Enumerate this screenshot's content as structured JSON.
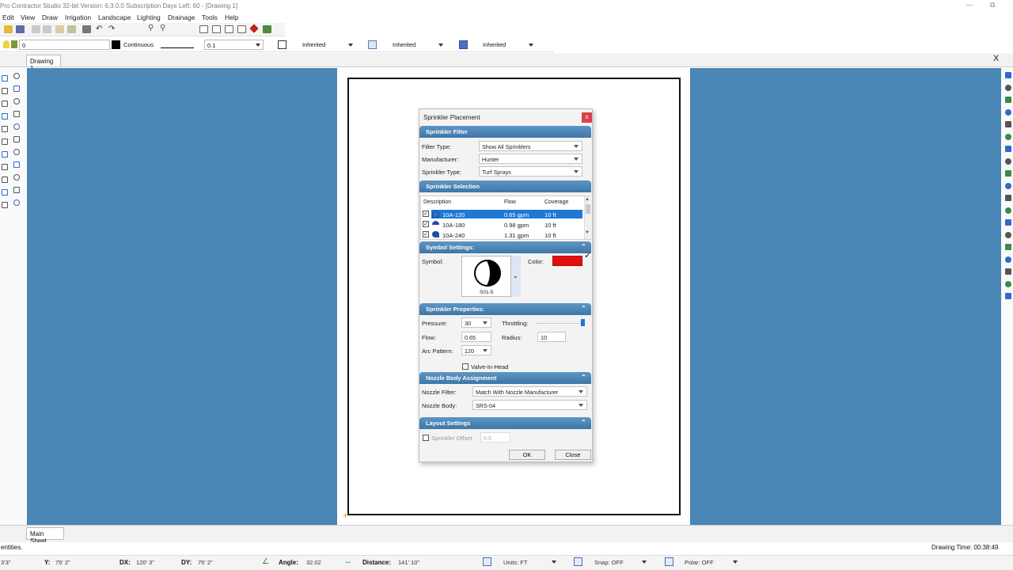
{
  "window": {
    "title": "Pro Contractor Studio 32-bit   Version: 6.3.0.0   Subscription Days Left: 60 - [Drawing 1]"
  },
  "menu": [
    "Edit",
    "View",
    "Draw",
    "Irrigation",
    "Landscape",
    "Lighting",
    "Drainage",
    "Tools",
    "Help"
  ],
  "toolbar2": {
    "layer_value": "0",
    "linetype": "Continuous",
    "lineweight": "0.1",
    "color_label": "Inherited",
    "linetype_label": "Inherited",
    "lineweight_label": "Inherited"
  },
  "doc_tab": "Drawing 1",
  "close_doc": "X",
  "dialog": {
    "title": "Sprinkler Placement",
    "filter": {
      "header": "Sprinkler Filter",
      "filter_type_label": "Filter Type:",
      "filter_type_value": "Show All Sprinklers",
      "manufacturer_label": "Manufacturer:",
      "manufacturer_value": "Hunter",
      "type_label": "Sprinkler Type:",
      "type_value": "Turf Sprays"
    },
    "selection": {
      "header": "Sprinkler Selection",
      "columns": [
        "Description",
        "Flow",
        "Coverage"
      ],
      "rows": [
        {
          "desc": "10A-120",
          "flow": "0.65 gpm",
          "cov": "10 ft"
        },
        {
          "desc": "10A-180",
          "flow": "0.98 gpm",
          "cov": "10 ft"
        },
        {
          "desc": "10A-240",
          "flow": "1.31 gpm",
          "cov": "10 ft"
        }
      ]
    },
    "symbol": {
      "header": "Symbol Settings:",
      "symbol_label": "Symbol:",
      "symbol_name": "S01-5",
      "color_label": "Color:",
      "color": "#e01010"
    },
    "properties": {
      "header": "Sprinkler Properties:",
      "pressure_label": "Pressure:",
      "pressure_value": "30",
      "throttling_label": "Throttling:",
      "throttling_level": 1.0,
      "flow_label": "Flow:",
      "flow_value": "0.65",
      "radius_label": "Radius:",
      "radius_value": "10",
      "arc_label": "Arc Pattern:",
      "arc_value": "120",
      "vih_label": "Valve-In-Head"
    },
    "nozzle": {
      "header": "Nozzle Body Assignment",
      "filter_label": "Nozzle Filter:",
      "filter_value": "Match With Nozzle Manufacturer",
      "body_label": "Nozzle Body:",
      "body_value": "SRS-04"
    },
    "layout": {
      "header": "Layout Settings",
      "offset_label": "Sprinkler Offset",
      "offset_value": "0.5"
    },
    "ok": "OK",
    "close": "Close",
    "close_x": "x"
  },
  "sheet_tab": "Main Sheet",
  "status": {
    "left_msg": "entities.",
    "drawing_time": "Drawing Time: 00:38:49",
    "x_label": "X:",
    "x_value": "3'3\"",
    "y_label": "Y:",
    "y_value": "75' 2\"",
    "dx_label": "DX:",
    "dx_value": "120' 3\"",
    "dy_label": "DY:",
    "dy_value": "75' 2\"",
    "angle_label": "Angle:",
    "angle_value": "32.02",
    "distance_label": "Distance:",
    "distance_value": "141' 10\"",
    "units": "Units: FT",
    "snap": "Snap: OFF",
    "polar": "Polar: OFF"
  },
  "colors": {
    "canvas_blue": "#4a86b6",
    "header_blue": "#4a83b4",
    "selection_blue": "#1e78d6"
  }
}
